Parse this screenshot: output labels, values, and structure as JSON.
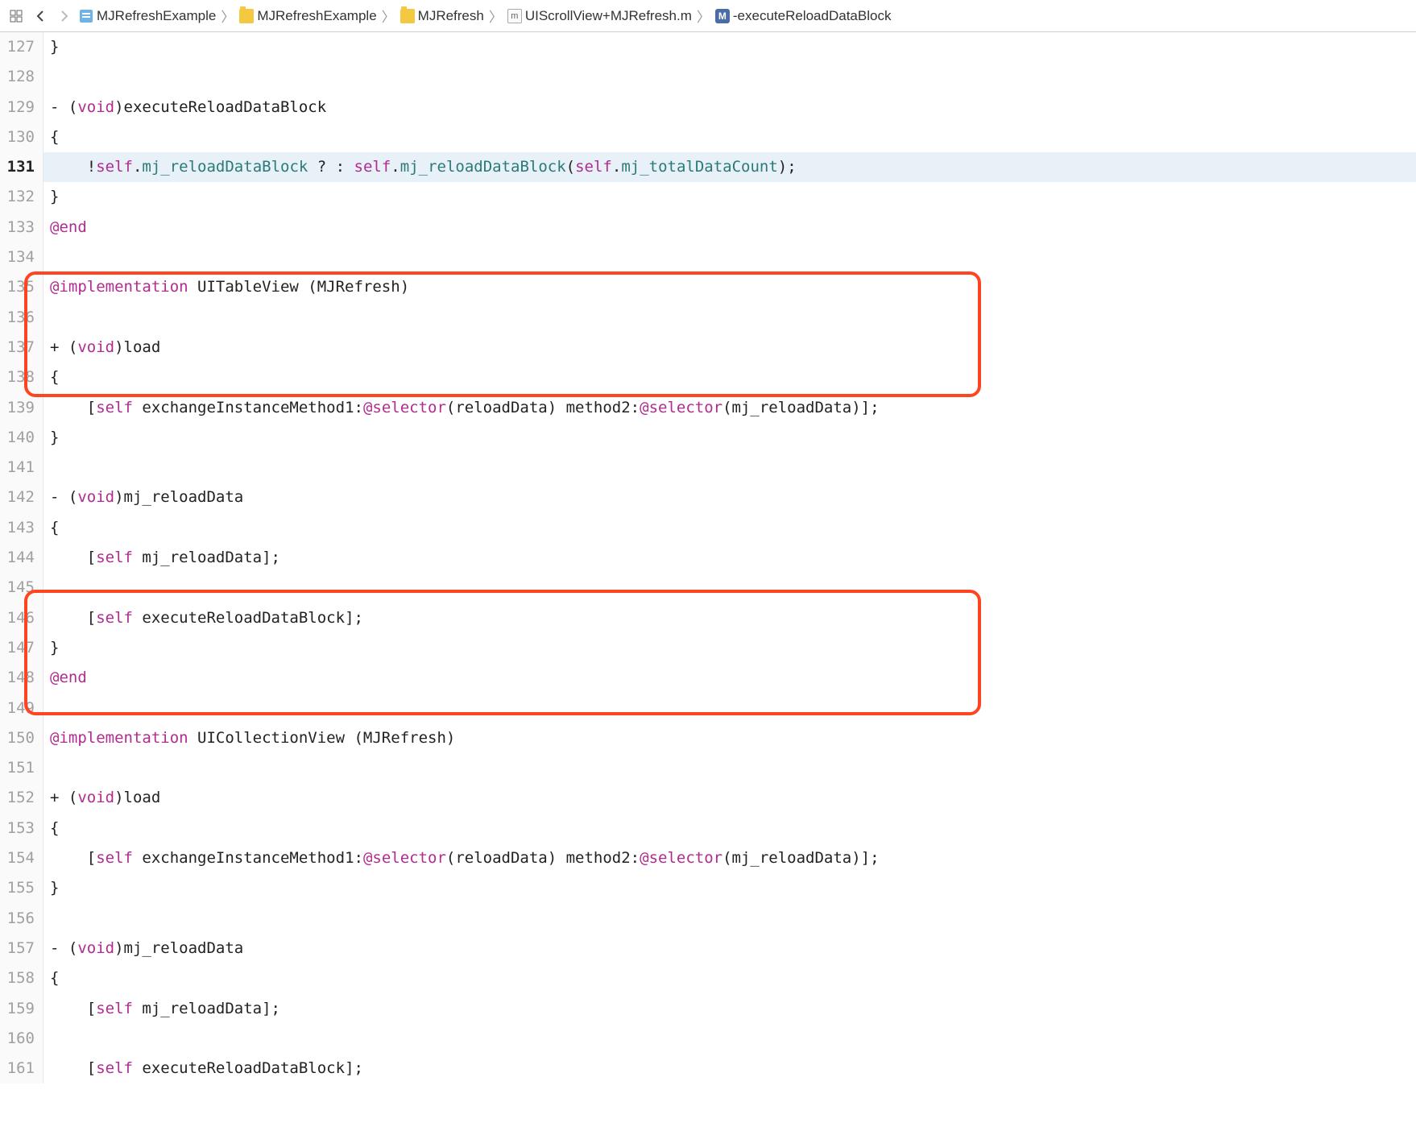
{
  "toolbar": {
    "back": "‹",
    "forward": "›"
  },
  "breadcrumb": {
    "project": "MJRefreshExample",
    "folder1": "MJRefreshExample",
    "folder2": "MJRefresh",
    "file_icon_label": "m",
    "file": "UIScrollView+MJRefresh.m",
    "method_icon_label": "M",
    "method": "-executeReloadDataBlock"
  },
  "lines": {
    "127": "}",
    "128": "",
    "129_pre": "- (",
    "129_void": "void",
    "129_post": ")executeReloadDataBlock",
    "130": "{",
    "131_a": "    !",
    "131_self1": "self",
    "131_b": ".",
    "131_prop1": "mj_reloadDataBlock",
    "131_c": " ? : ",
    "131_self2": "self",
    "131_d": ".",
    "131_prop2": "mj_reloadDataBlock",
    "131_e": "(",
    "131_self3": "self",
    "131_f": ".",
    "131_prop3": "mj_totalDataCount",
    "131_g": ");",
    "132": "}",
    "133": "@end",
    "134": "",
    "135_impl": "@implementation",
    "135_rest": " UITableView (MJRefresh)",
    "136": "",
    "137_pre": "+ (",
    "137_void": "void",
    "137_post": ")load",
    "138": "{",
    "139_a": "    [",
    "139_self": "self",
    "139_b": " exchangeInstanceMethod1:",
    "139_sel1": "@selector",
    "139_c": "(reloadData) method2:",
    "139_sel2": "@selector",
    "139_d": "(mj_reloadData)];",
    "140": "}",
    "141": "",
    "142_pre": "- (",
    "142_void": "void",
    "142_post": ")mj_reloadData",
    "143": "{",
    "144_a": "    [",
    "144_self": "self",
    "144_b": " mj_reloadData];",
    "145": "",
    "146_a": "    [",
    "146_self": "self",
    "146_b": " executeReloadDataBlock];",
    "147": "}",
    "148": "@end",
    "149": "",
    "150_impl": "@implementation",
    "150_rest": " UICollectionView (MJRefresh)",
    "151": "",
    "152_pre": "+ (",
    "152_void": "void",
    "152_post": ")load",
    "153": "{",
    "154_a": "    [",
    "154_self": "self",
    "154_b": " exchangeInstanceMethod1:",
    "154_sel1": "@selector",
    "154_c": "(reloadData) method2:",
    "154_sel2": "@selector",
    "154_d": "(mj_reloadData)];",
    "155": "}",
    "156": "",
    "157_pre": "- (",
    "157_void": "void",
    "157_post": ")mj_reloadData",
    "158": "{",
    "159_a": "    [",
    "159_self": "self",
    "159_b": " mj_reloadData];",
    "160": "",
    "161_a": "    [",
    "161_self": "self",
    "161_b": " executeReloadDataBlock];"
  },
  "line_numbers": [
    "127",
    "128",
    "129",
    "130",
    "131",
    "132",
    "133",
    "134",
    "135",
    "136",
    "137",
    "138",
    "139",
    "140",
    "141",
    "142",
    "143",
    "144",
    "145",
    "146",
    "147",
    "148",
    "149",
    "150",
    "151",
    "152",
    "153",
    "154",
    "155",
    "156",
    "157",
    "158",
    "159",
    "160",
    "161"
  ]
}
